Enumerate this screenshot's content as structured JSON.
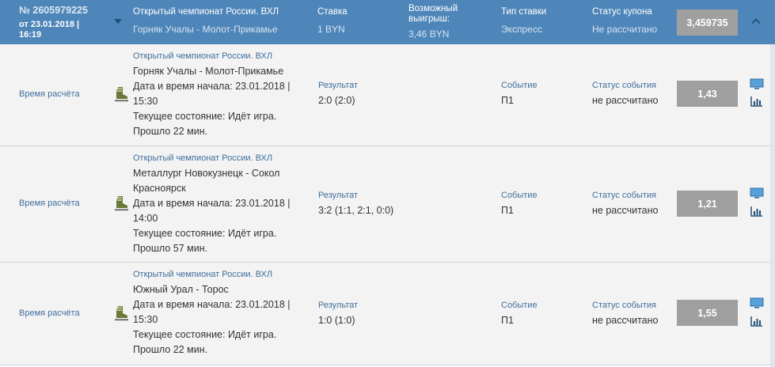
{
  "coupon": {
    "number": "№ 2605979225",
    "date": "от 23.01.2018 | 16:19",
    "championship": "Открытый чемпионат России. ВХЛ",
    "match": "Горняк Учалы - Молот-Прикамье",
    "stake_label": "Ставка",
    "stake_value": "1 BYN",
    "win_label": "Возможный выигрыш:",
    "win_value": "3,46 BYN",
    "type_label": "Тип ставки",
    "type_value": "Экспресс",
    "status_label": "Статус купона",
    "status_value": "Не рассчитано",
    "total_coef": "3,459735",
    "icons": {
      "dropdown": "caret-down-icon",
      "collapse": "chevron-up-icon"
    }
  },
  "events": [
    {
      "calc_label": "Время расчёта",
      "championship": "Открытый чемпионат России. ВХЛ",
      "lines": [
        "Горняк Учалы - Молот-Прикамье",
        "Дата и время начала: 23.01.2018 |",
        "15:30",
        "Текущее состояние: Идёт игра.",
        "Прошло 22 мин."
      ],
      "result_label": "Результат",
      "result_value": "2:0 (2:0)",
      "event_label": "Событие",
      "event_value": "П1",
      "status_label": "Статус события",
      "status_value": "не рассчитано",
      "coef": "1,43"
    },
    {
      "calc_label": "Время расчёта",
      "championship": "Открытый чемпионат России. ВХЛ",
      "lines": [
        "Металлург Новокузнецк - Сокол",
        "Красноярск",
        "Дата и время начала: 23.01.2018 |",
        "14:00",
        "Текущее состояние: Идёт игра.",
        "Прошло 57 мин."
      ],
      "result_label": "Результат",
      "result_value": "3:2 (1:1, 2:1, 0:0)",
      "event_label": "Событие",
      "event_value": "П1",
      "status_label": "Статус события",
      "status_value": "не рассчитано",
      "coef": "1,21"
    },
    {
      "calc_label": "Время расчёта",
      "championship": "Открытый чемпионат России. ВХЛ",
      "lines": [
        "Южный Урал - Торос",
        "Дата и время начала: 23.01.2018 |",
        "15:30",
        "Текущее состояние: Идёт игра.",
        "Прошло 22 мин."
      ],
      "result_label": "Результат",
      "result_value": "1:0 (1:0)",
      "event_label": "Событие",
      "event_value": "П1",
      "status_label": "Статус события",
      "status_value": "не рассчитано",
      "coef": "1,55"
    }
  ],
  "event_icons": {
    "sport": "hockey-skate-icon",
    "tv": "tv-broadcast-icon",
    "stats": "statistics-icon"
  },
  "colors": {
    "header": "#4f86b9",
    "row": "#f3f3f3",
    "coef": "#9f9f9f",
    "label": "#3f6f9d"
  }
}
